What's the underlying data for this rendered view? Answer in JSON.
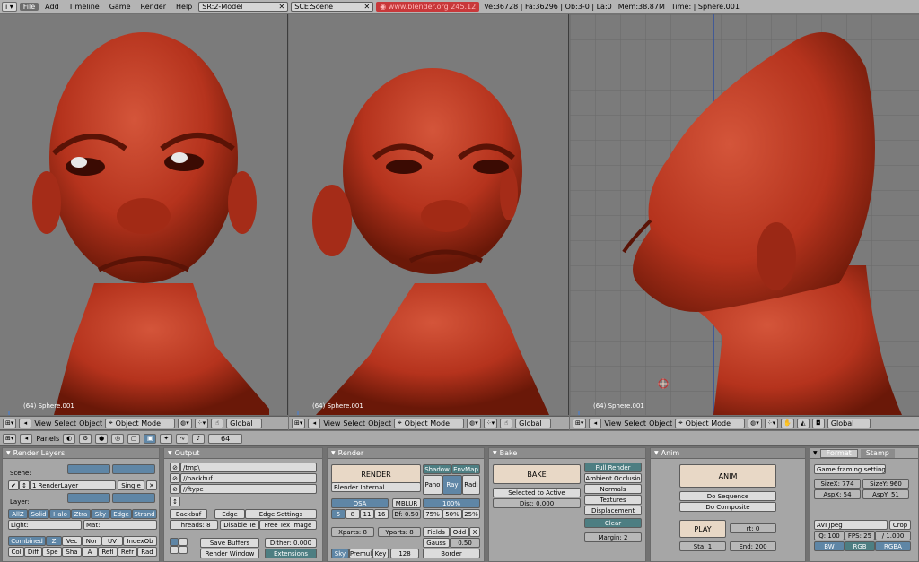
{
  "topbar": {
    "menus": [
      "File",
      "Add",
      "Timeline",
      "Game",
      "Render",
      "Help"
    ],
    "screen": "SR:2-Model",
    "scene": "SCE:Scene",
    "url": "www.blender.org 245.12",
    "stats": "Ve:36728 | Fa:36296 | Ob:3-0 | La:0",
    "mem": "Mem:38.87M",
    "time": "Time: | Sphere.001"
  },
  "viewports": [
    {
      "label": "(64) Sphere.001"
    },
    {
      "label": "(64) Sphere.001"
    },
    {
      "label": "(64) Sphere.001"
    }
  ],
  "vpheader": {
    "view": "View",
    "select": "Select",
    "object": "Object",
    "mode": "Object Mode",
    "orient": "Global"
  },
  "buttons_header": {
    "panels": "Panels",
    "frame": "64"
  },
  "colors": {
    "head": "#b5331d",
    "accent": "#5f86a6"
  },
  "render_layers": {
    "title": "Render Layers",
    "scene": "Scene:",
    "layer_name": "1 RenderLayer",
    "single": "Single",
    "layer": "Layer:",
    "light": "Light:",
    "mat": "Mat:",
    "passes1": [
      "AllZ",
      "Solid",
      "Halo",
      "Ztra",
      "Sky",
      "Edge",
      "Strand"
    ],
    "passes2": [
      "Combined",
      "Z",
      "Vec",
      "Nor",
      "UV",
      "IndexOb"
    ],
    "passes3": [
      "Col",
      "Diff",
      "Spe",
      "Sha",
      "A",
      "Refl",
      "Refr",
      "Rad"
    ]
  },
  "output": {
    "title": "Output",
    "paths": [
      "/tmp\\",
      "//backbuf",
      "//ftype"
    ],
    "backbuf": "Backbuf",
    "edge": "Edge",
    "edge_settings": "Edge Settings",
    "threads": "Threads: 8",
    "disable_te": "Disable Te",
    "free_tex": "Free Tex Image",
    "save_buffers": "Save Buffers",
    "dither": "Dither: 0.000",
    "render_window": "Render Window",
    "extensions": "Extensions"
  },
  "render": {
    "title": "Render",
    "render_btn": "RENDER",
    "engine": "Blender Internal",
    "shadow": "Shadow",
    "envmap": "EnvMap",
    "pano": "Pano",
    "ray": "Ray",
    "radi": "Radi",
    "osa": "OSA",
    "osa_vals": [
      "5",
      "8",
      "11",
      "16"
    ],
    "mblur": "MBLUR",
    "bf": "Bf: 0.50",
    "pct": "100%",
    "pcts": [
      "75%",
      "50%",
      "25%"
    ],
    "xparts": "Xparts: 8",
    "yparts": "Yparts: 8",
    "fields": "Fields",
    "odd": "Odd",
    "x": "X",
    "gauss": "Gauss",
    "gauss_val": "0.50",
    "sky": "Sky",
    "premul": "Premul",
    "key": "Key",
    "depth": "128",
    "border": "Border"
  },
  "bake": {
    "title": "Bake",
    "bake_btn": "BAKE",
    "selected": "Selected to Active",
    "dist": "Dist: 0.000",
    "modes": [
      "Full Render",
      "Ambient Occlusio",
      "Normals",
      "Textures",
      "Displacement"
    ],
    "clear": "Clear",
    "margin": "Margin: 2"
  },
  "anim": {
    "title": "Anim",
    "anim_btn": "ANIM",
    "do_sequence": "Do Sequence",
    "do_composite": "Do Composite",
    "play": "PLAY",
    "rt": "rt: 0",
    "sta": "Sta: 1",
    "end": "End: 200"
  },
  "format": {
    "tab1": "Format",
    "tab2": "Stamp",
    "preset": "Game framing settings",
    "sizex": "SizeX: 774",
    "sizey": "SizeY: 960",
    "aspx": "AspX: 54",
    "aspy": "AspY: 51",
    "codec": "AVI Jpeg",
    "crop": "Crop",
    "q": "Q: 100",
    "fps": "FPS: 25",
    "fpsdiv": "/ 1.000",
    "bw": "BW",
    "rgb": "RGB",
    "rgba": "RGBA"
  }
}
